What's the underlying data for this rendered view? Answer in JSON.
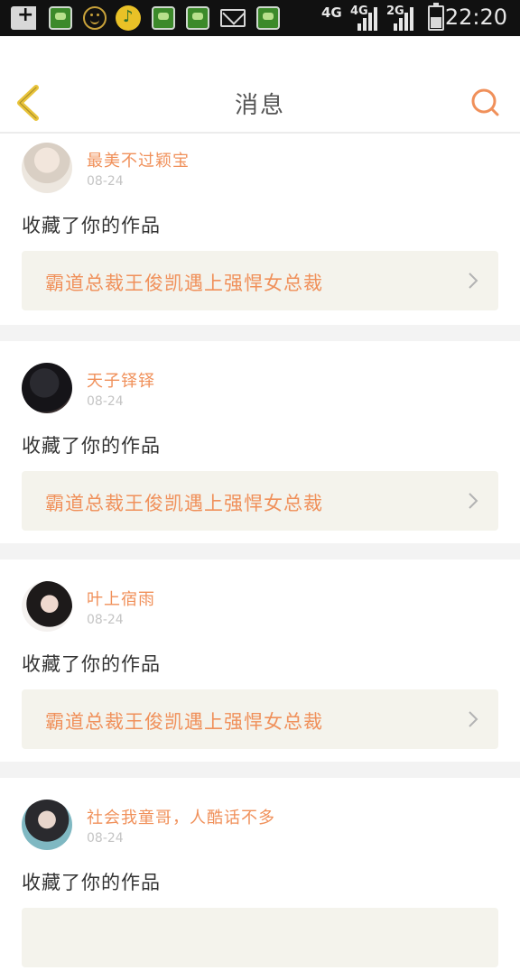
{
  "status_bar": {
    "time": "22:20",
    "network_1": "4G",
    "network_2": "4G",
    "network_3": "2G",
    "icons": [
      "add-icon",
      "app-icon",
      "face-icon",
      "app-icon",
      "app-icon",
      "music-icon",
      "mail-icon",
      "app-icon",
      "signal-icon",
      "signal-icon",
      "signal-icon",
      "battery-icon"
    ]
  },
  "header": {
    "title": "消息",
    "back_icon": "chevron-left-icon",
    "search_icon": "search-icon",
    "accent_color": "#f0905a",
    "back_color": "#e8c33a"
  },
  "messages": [
    {
      "user": "最美不过颖宝",
      "time": "08-24",
      "action": "收藏了你的作品",
      "work_title": "霸道总裁王俊凯遇上强悍女总裁"
    },
    {
      "user": "天子铎铎",
      "time": "08-24",
      "action": "收藏了你的作品",
      "work_title": "霸道总裁王俊凯遇上强悍女总裁"
    },
    {
      "user": "叶上宿雨",
      "time": "08-24",
      "action": "收藏了你的作品",
      "work_title": "霸道总裁王俊凯遇上强悍女总裁"
    },
    {
      "user": "社会我童哥，人酷话不多",
      "time": "08-24",
      "action": "收藏了你的作品",
      "work_title": ""
    }
  ]
}
